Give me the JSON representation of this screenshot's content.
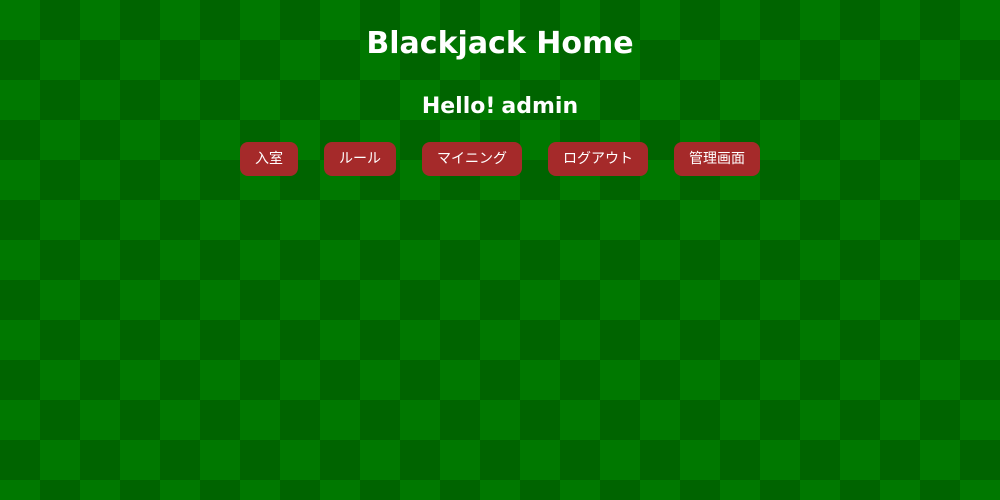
{
  "header": {
    "title": "Blackjack Home",
    "greeting": "Hello!",
    "username": "admin"
  },
  "nav": {
    "items": [
      {
        "label": "入室"
      },
      {
        "label": "ルール"
      },
      {
        "label": "マイニング"
      },
      {
        "label": "ログアウト"
      },
      {
        "label": "管理画面"
      }
    ]
  },
  "colors": {
    "background_light": "#007800",
    "background_dark": "#006400",
    "button": "#a52a2a",
    "text": "#ffffff"
  }
}
